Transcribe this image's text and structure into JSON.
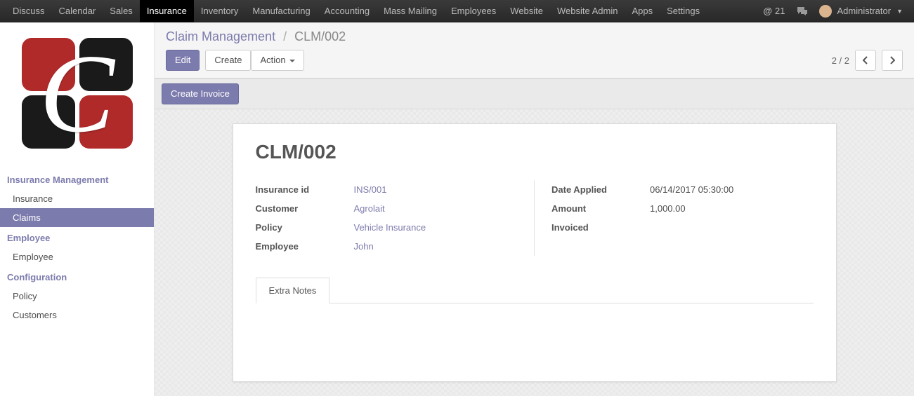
{
  "topnav": {
    "items": [
      "Discuss",
      "Calendar",
      "Sales",
      "Insurance",
      "Inventory",
      "Manufacturing",
      "Accounting",
      "Mass Mailing",
      "Employees",
      "Website",
      "Website Admin",
      "Apps",
      "Settings"
    ],
    "active_index": 3,
    "mail_count": "21",
    "user_label": "Administrator"
  },
  "sidebar": {
    "sections": [
      {
        "title": "Insurance Management",
        "items": [
          {
            "label": "Insurance"
          },
          {
            "label": "Claims",
            "active": true
          }
        ]
      },
      {
        "title": "Employee",
        "items": [
          {
            "label": "Employee"
          }
        ]
      },
      {
        "title": "Configuration",
        "items": [
          {
            "label": "Policy"
          },
          {
            "label": "Customers"
          }
        ]
      }
    ]
  },
  "breadcrumb": {
    "parent": "Claim Management",
    "current": "CLM/002"
  },
  "toolbar": {
    "edit": "Edit",
    "create": "Create",
    "action": "Action"
  },
  "pager": {
    "text": "2 / 2"
  },
  "statusbar": {
    "create_invoice": "Create Invoice"
  },
  "record": {
    "title": "CLM/002",
    "left": [
      {
        "label": "Insurance id",
        "value": "INS/001",
        "link": true
      },
      {
        "label": "Customer",
        "value": "Agrolait",
        "link": true
      },
      {
        "label": "Policy",
        "value": "Vehicle Insurance",
        "link": true
      },
      {
        "label": "Employee",
        "value": "John",
        "link": true
      }
    ],
    "right": [
      {
        "label": "Date Applied",
        "value": "06/14/2017 05:30:00",
        "link": false
      },
      {
        "label": "Amount",
        "value": "1,000.00",
        "link": false
      },
      {
        "label": "Invoiced",
        "value": "",
        "link": false
      }
    ]
  },
  "tabs": {
    "extra_notes": "Extra Notes"
  }
}
